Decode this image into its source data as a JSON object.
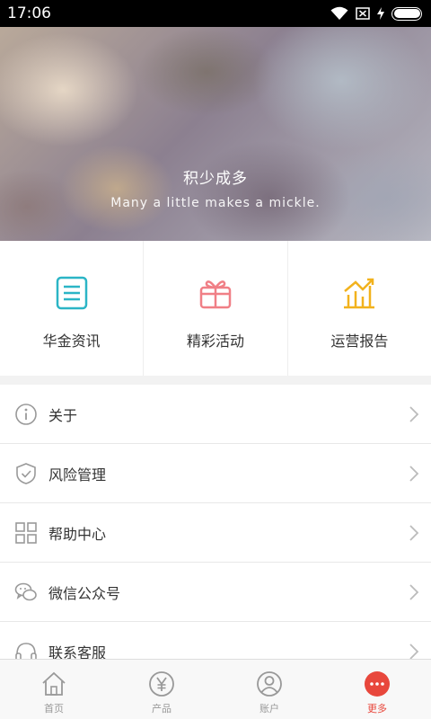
{
  "status_bar": {
    "time": "17:06"
  },
  "banner": {
    "title": "积少成多",
    "subtitle": "Many a little makes a mickle."
  },
  "quick_links": [
    {
      "label": "华金资讯",
      "icon": "document-icon",
      "color": "#2bb5c6"
    },
    {
      "label": "精彩活动",
      "icon": "gift-icon",
      "color": "#f07f86"
    },
    {
      "label": "运营报告",
      "icon": "chart-icon",
      "color": "#f2b21d"
    }
  ],
  "menu": [
    {
      "label": "关于",
      "icon": "info-icon"
    },
    {
      "label": "风险管理",
      "icon": "shield-icon"
    },
    {
      "label": "帮助中心",
      "icon": "grid-icon"
    },
    {
      "label": "微信公众号",
      "icon": "wechat-icon"
    },
    {
      "label": "联系客服",
      "icon": "headset-icon"
    }
  ],
  "tab_bar": [
    {
      "label": "首页",
      "icon": "home-icon",
      "active": false
    },
    {
      "label": "产品",
      "icon": "yen-icon",
      "active": false
    },
    {
      "label": "账户",
      "icon": "user-icon",
      "active": false
    },
    {
      "label": "更多",
      "icon": "more-icon",
      "active": true
    }
  ],
  "colors": {
    "accent": "#e8473c"
  }
}
